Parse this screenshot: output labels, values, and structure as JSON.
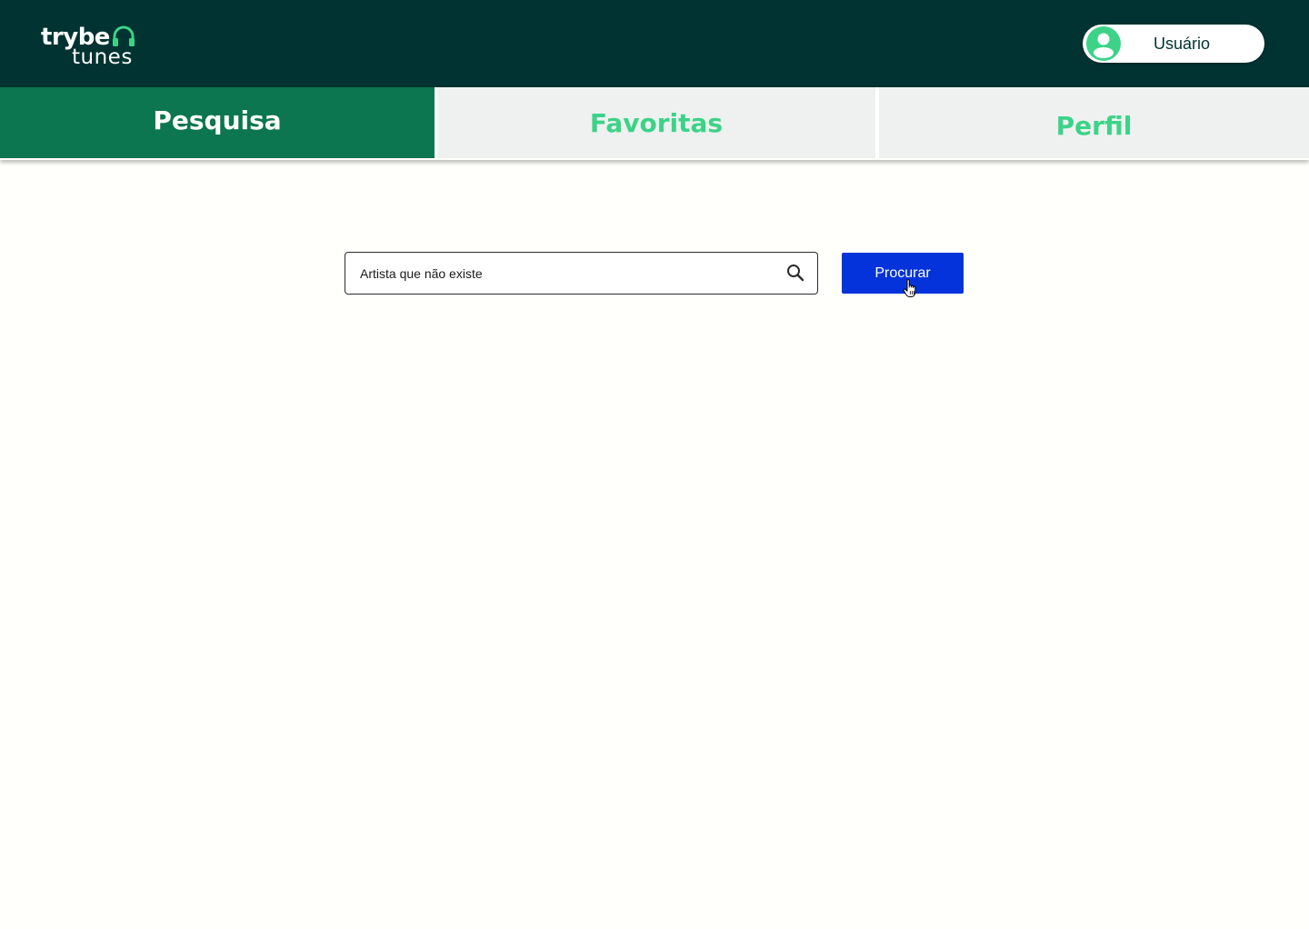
{
  "header": {
    "logo": {
      "word_top": "trybe",
      "word_bottom": "tunes",
      "icon": "headphones-icon"
    },
    "user": {
      "name": "Usuário",
      "icon": "user-avatar-icon"
    }
  },
  "tabs": [
    {
      "label": "Pesquisa",
      "active": true
    },
    {
      "label": "Favoritas",
      "active": false
    },
    {
      "label": "Perfil",
      "active": false
    }
  ],
  "search": {
    "value": "Artista que não existe",
    "icon": "search-icon",
    "button_label": "Procurar"
  },
  "colors": {
    "header_bg": "#003331",
    "tab_active_bg": "#0b7650",
    "tab_inactive_bg": "#eff1f0",
    "tab_inactive_text": "#3cd388",
    "accent_green": "#3cd388",
    "button_bg": "#0433db",
    "page_bg": "#fffffb"
  }
}
